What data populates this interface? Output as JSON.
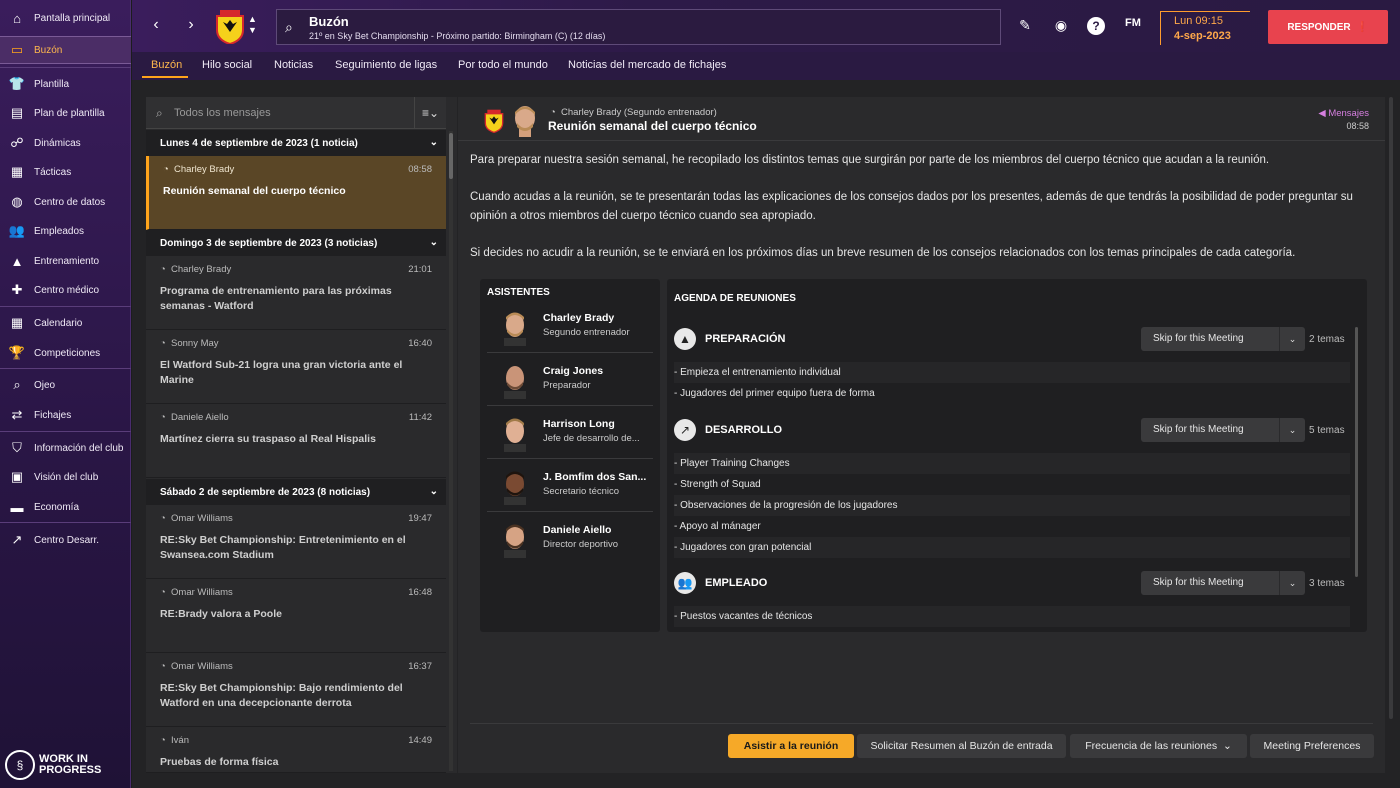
{
  "sidebar": {
    "items": [
      {
        "label": "Pantalla principal",
        "icon": "home-icon"
      },
      {
        "label": "Buzón",
        "icon": "inbox-icon"
      },
      {
        "label": "Plantilla",
        "icon": "squad-icon"
      },
      {
        "label": "Plan de plantilla",
        "icon": "squad-plan-icon"
      },
      {
        "label": "Dinámicas",
        "icon": "dynamics-icon"
      },
      {
        "label": "Tácticas",
        "icon": "tactics-icon"
      },
      {
        "label": "Centro de datos",
        "icon": "data-hub-icon"
      },
      {
        "label": "Empleados",
        "icon": "staff-icon"
      },
      {
        "label": "Entrenamiento",
        "icon": "training-icon"
      },
      {
        "label": "Centro médico",
        "icon": "medical-icon"
      },
      {
        "label": "Calendario",
        "icon": "calendar-icon"
      },
      {
        "label": "Competiciones",
        "icon": "trophy-icon"
      },
      {
        "label": "Ojeo",
        "icon": "scouting-icon"
      },
      {
        "label": "Fichajes",
        "icon": "transfers-icon"
      },
      {
        "label": "Información del club",
        "icon": "club-info-icon"
      },
      {
        "label": "Visión del club",
        "icon": "club-vision-icon"
      },
      {
        "label": "Economía",
        "icon": "finances-icon"
      },
      {
        "label": "Centro Desarr.",
        "icon": "dev-centre-icon"
      }
    ],
    "wip_label_1": "WORK IN",
    "wip_label_2": "PROGRESS"
  },
  "topbar": {
    "title": "Buzón",
    "subtitle": "21º en Sky Bet Championship - Próximo partido: Birmingham (C) (12 días)",
    "fm_label": "FM",
    "time": "Lun 09:15",
    "date": "4-sep-2023",
    "respond_label": "RESPONDER"
  },
  "tabs": [
    "Buzón",
    "Hilo social",
    "Noticias",
    "Seguimiento de ligas",
    "Por todo el mundo",
    "Noticias del mercado de fichajes"
  ],
  "inbox": {
    "search_placeholder": "Todos los mensajes",
    "groups": [
      {
        "label": "Lunes 4 de septiembre de 2023 (1 noticia)"
      },
      {
        "label": "Domingo 3 de septiembre de 2023 (3 noticias)"
      },
      {
        "label": "Sábado 2 de septiembre de 2023 (8 noticias)"
      }
    ],
    "messages": [
      {
        "from": "Charley Brady",
        "time": "08:58",
        "title": "Reunión semanal del cuerpo técnico"
      },
      {
        "from": "Charley Brady",
        "time": "21:01",
        "title": "Programa de entrenamiento para las próximas semanas - Watford"
      },
      {
        "from": "Sonny May",
        "time": "16:40",
        "title": "El Watford Sub-21 logra una gran victoria ante el Marine"
      },
      {
        "from": "Daniele Aiello",
        "time": "11:42",
        "title": "Martínez cierra su traspaso al Real Hispalis"
      },
      {
        "from": "Omar Williams",
        "time": "19:47",
        "title": "RE:Sky Bet Championship: Entretenimiento en el Swansea.com Stadium"
      },
      {
        "from": "Omar Williams",
        "time": "16:48",
        "title": "RE:Brady valora a Poole"
      },
      {
        "from": "Omar Williams",
        "time": "16:37",
        "title": "RE:Sky Bet Championship: Bajo rendimiento del Watford en una decepcionante derrota"
      },
      {
        "from": "Iván",
        "time": "14:49",
        "title": "Pruebas de forma física"
      }
    ]
  },
  "reader": {
    "from": "Charley Brady  (Segundo entrenador)",
    "subject": "Reunión semanal del cuerpo técnico",
    "tag": "Mensajes",
    "time": "08:58",
    "p1": "Para preparar nuestra sesión semanal, he recopilado los distintos temas que surgirán por parte de los miembros del cuerpo técnico que acudan a la reunión.",
    "p2": "Cuando acudas a la reunión, se te presentarán todas las explicaciones de los consejos dados por los presentes, además de que tendrás la posibilidad de poder preguntar su opinión a otros miembros del cuerpo técnico cuando sea apropiado.",
    "p3": "Si decides no acudir a la reunión, se te enviará en los próximos días un breve resumen de los consejos relacionados con los temas principales de cada categoría.",
    "attendees_title": "ASISTENTES",
    "attendees": [
      {
        "name": "Charley Brady",
        "role": "Segundo entrenador"
      },
      {
        "name": "Craig Jones",
        "role": "Preparador"
      },
      {
        "name": "Harrison Long",
        "role": "Jefe de desarrollo de..."
      },
      {
        "name": "J. Bomfim dos San...",
        "role": "Secretario técnico"
      },
      {
        "name": "Daniele Aiello",
        "role": "Director deportivo"
      }
    ],
    "agenda_title": "AGENDA DE REUNIONES",
    "categories": [
      {
        "name": "PREPARACIÓN",
        "option": "Skip for this Meeting",
        "count": "2 temas",
        "items": [
          "- Empieza el entrenamiento individual",
          "- Jugadores del primer equipo fuera de forma"
        ]
      },
      {
        "name": "DESARROLLO",
        "option": "Skip for this Meeting",
        "count": "5 temas",
        "items": [
          "- Player Training Changes",
          "- Strength of Squad",
          "- Observaciones de la progresión de los jugadores",
          "- Apoyo al mánager",
          "- Jugadores con gran potencial"
        ]
      },
      {
        "name": "EMPLEADO",
        "option": "Skip for this Meeting",
        "count": "3 temas",
        "items": [
          "- Puestos vacantes de técnicos"
        ]
      }
    ],
    "buttons": {
      "attend": "Asistir a la reunión",
      "summary": "Solicitar Resumen al Buzón de entrada",
      "frequency": "Frecuencia de las reuniones",
      "preferences": "Meeting Preferences"
    }
  },
  "colors": {
    "accent": "#ffa41b",
    "respond": "#e8434e",
    "primary_button": "#f6a928",
    "sidebar": "#3a1d5c"
  }
}
